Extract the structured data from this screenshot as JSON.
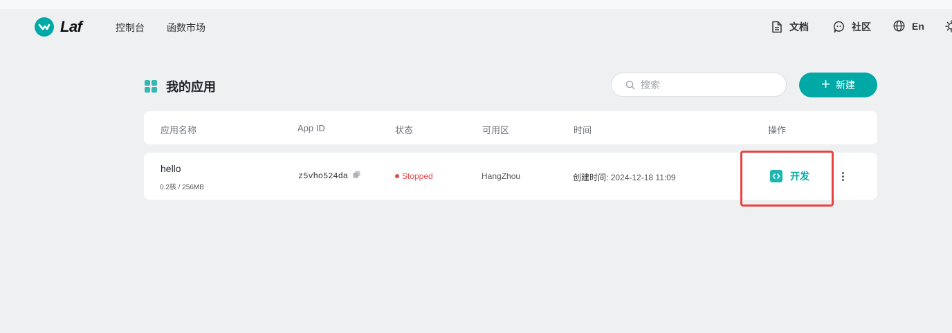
{
  "header": {
    "logo_text": "Laf",
    "nav": [
      "控制台",
      "函数市场"
    ],
    "docs_label": "文档",
    "community_label": "社区",
    "language_label": "En"
  },
  "page": {
    "title": "我的应用",
    "search_placeholder": "搜索",
    "new_button_label": "新建"
  },
  "table": {
    "columns": [
      "应用名称",
      "App ID",
      "状态",
      "可用区",
      "时间",
      "操作"
    ],
    "rows": [
      {
        "name": "hello",
        "spec": "0.2核 / 256MB",
        "app_id": "z5vho524da",
        "status": "Stopped",
        "region": "HangZhou",
        "time_label": "创建时间:",
        "time_value": "2024-12-18 11:09",
        "action_label": "开发"
      }
    ]
  },
  "colors": {
    "accent": "#00a9a6",
    "status_stopped": "#e5484d",
    "highlight_border": "#e8433e"
  }
}
